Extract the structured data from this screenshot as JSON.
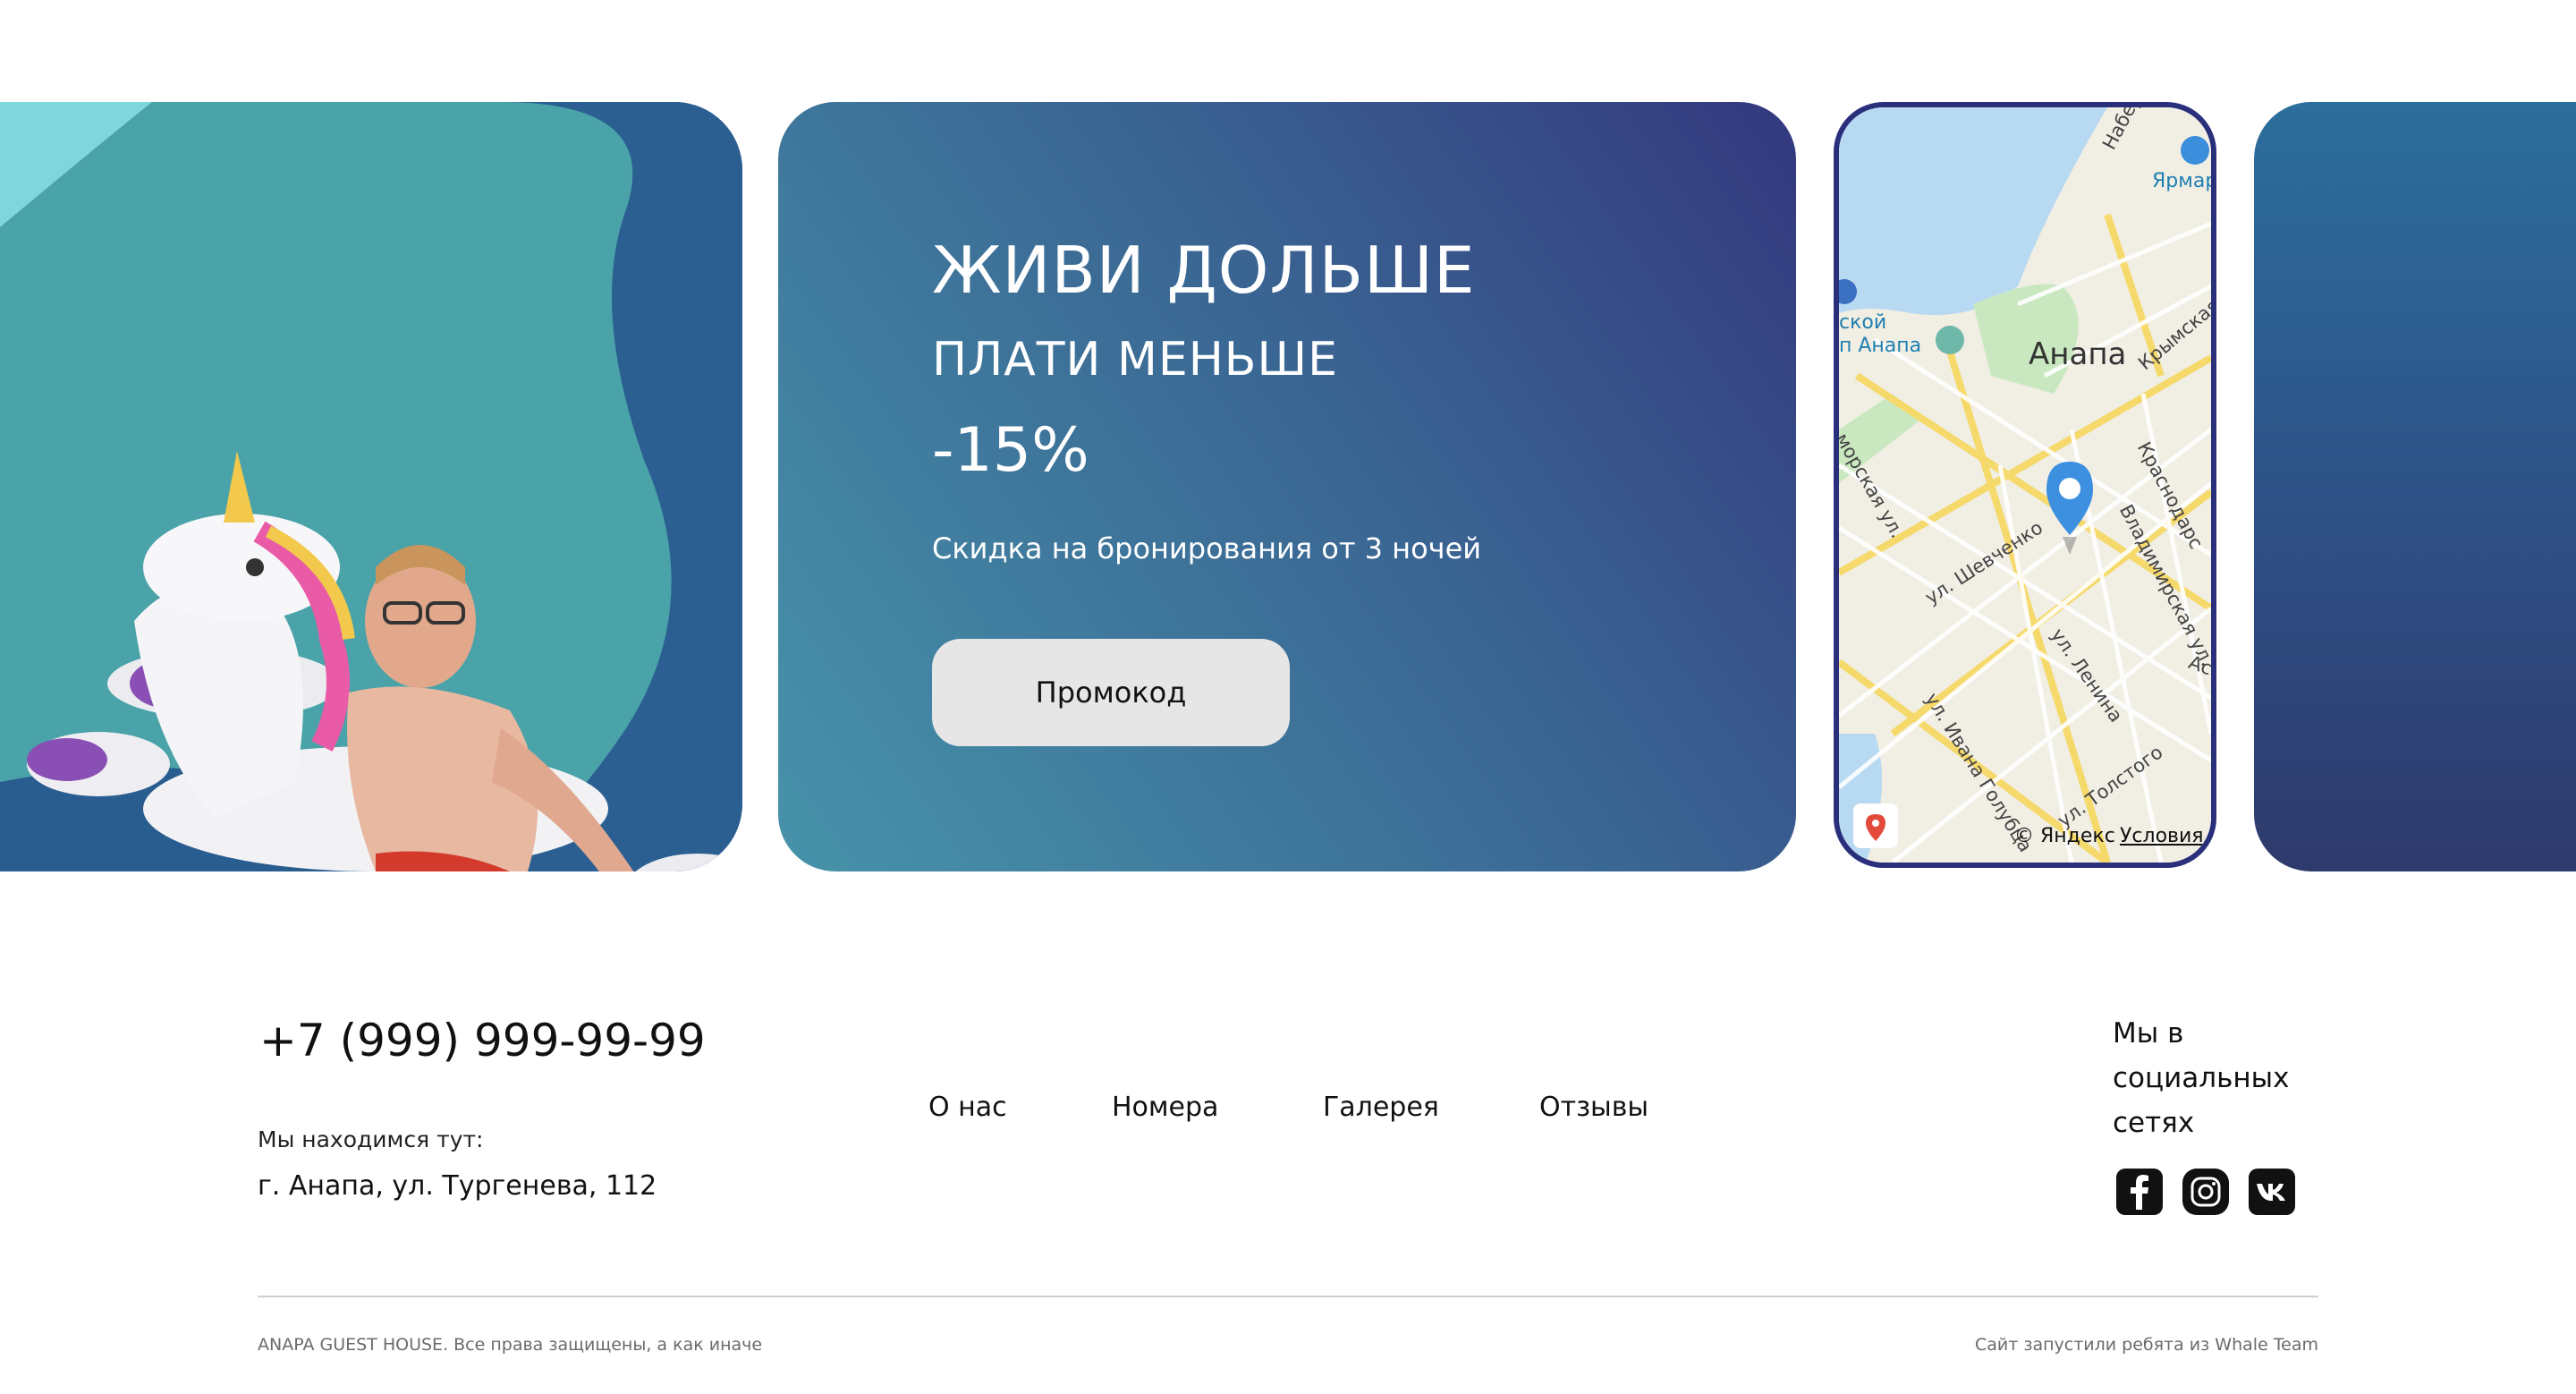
{
  "promo": {
    "title": "ЖИВИ ДОЛЬШЕ",
    "subtitle": "ПЛАТИ МЕНЬШЕ",
    "discount": "-15%",
    "description": "Скидка на бронирования от 3 ночей",
    "button_label": "Промокод"
  },
  "map": {
    "city": "Анапа",
    "poi_market": "Ярмар",
    "poi_left_1": "ской",
    "poi_left_2": "п Анапа",
    "streets": {
      "naberezh": "Набережн",
      "krymskaya": "Крымская",
      "krasnodar": "Краснодарс",
      "morskaya": "морская ул.",
      "shevchenko": "ул. Шевченко",
      "vladimirskaya": "Владимирская ул.",
      "lenina": "ул. Ленина",
      "ast": "Аст",
      "ivana_golubca": "ул. Ивана Голубца",
      "tolstogo": "ул. Толстого"
    },
    "copyright": "© Яндекс",
    "terms": "Условия"
  },
  "footer": {
    "phone": "+7 (999) 999-99-99",
    "location_label": "Мы находимся тут:",
    "address": "г. Анапа, ул. Тургенева, 112",
    "nav": [
      "О нас",
      "Номера",
      "Галерея",
      "Отзывы"
    ],
    "social_title": "Мы в социальных сетях",
    "social_icons": [
      "facebook-icon",
      "instagram-icon",
      "vk-icon"
    ],
    "copyright_left": "ANAPA GUEST HOUSE. Все права защищены, а как иначе",
    "copyright_right": "Сайт запустили ребята из Whale Team"
  },
  "colors": {
    "promo_gradient_start": "#34387e",
    "promo_gradient_end": "#4793aa",
    "button_bg": "#e6e6e6",
    "map_border": "#2a2f7c",
    "map_pin": "#3d8fe0"
  }
}
